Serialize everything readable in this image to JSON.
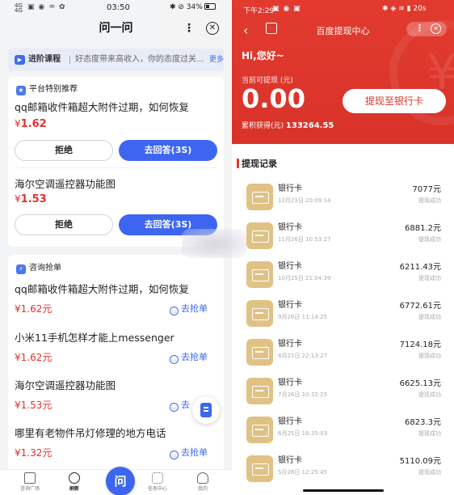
{
  "left": {
    "status": {
      "network": "4G 4G",
      "icons": "▣ ◉ ♒ ✿",
      "time": "03:50",
      "right": "✱ ⊘ 34%"
    },
    "title": "问一问",
    "more_label": "⋮",
    "close_label": "✕",
    "banner": {
      "tag": "进阶课程",
      "text": "好态度带来高收入，你的态度过关...",
      "more": "更多"
    },
    "section1": {
      "title": "平台特别推荐"
    },
    "recommended": [
      {
        "title": "qq邮箱收件箱超大附件过期，如何恢复",
        "price_symbol": "¥",
        "price": "1.62",
        "reject": "拒绝",
        "answer": "去回答(3S)"
      },
      {
        "title": "海尔空调遥控器功能图",
        "price_symbol": "¥",
        "price": "1.53",
        "reject": "拒绝",
        "answer": "去回答(3S)"
      }
    ],
    "section2": {
      "title": "咨询抢单"
    },
    "consult": [
      {
        "title": "qq邮箱收件箱超大附件过期，如何恢复",
        "price": "¥1.62元",
        "grab": "去抢单"
      },
      {
        "title": "小米11手机怎样才能上messenger",
        "price": "¥1.62元",
        "grab": "去抢单"
      },
      {
        "title": "海尔空调遥控器功能图",
        "price": "¥1.53元",
        "grab": "去"
      },
      {
        "title": "哪里有老物件吊灯修理的地方电话",
        "price": "¥1.32元",
        "grab": "去抢单"
      }
    ],
    "tabbar": [
      {
        "label": "咨询广场",
        "icon": "home-icon"
      },
      {
        "label": "刷新",
        "icon": "refresh-icon"
      },
      {
        "label": "问",
        "icon": "ask-icon"
      },
      {
        "label": "任务中心",
        "icon": "task-icon"
      },
      {
        "label": "我的",
        "icon": "profile-icon"
      }
    ]
  },
  "right": {
    "status": {
      "time": "下午2:29",
      "apps": "▣ ◉ ▣",
      "right": "✱ ◈ ≋ ▮ 20s"
    },
    "back_label": "‹",
    "title": "百度提现中心",
    "dots_label": "⋮",
    "close_label": "✕",
    "greeting": "Hi,您好~",
    "available_label": "当前可提现 (元)",
    "available_amount": "0.00",
    "withdraw_button": "提现至银行卡",
    "accum_label": "累积获得(元)",
    "accum_amount": "133264.55",
    "records_title": "提现记录",
    "records": [
      {
        "name": "银行卡",
        "date": "12月23日 20:09:14",
        "amount": "7077元",
        "status": "提现成功"
      },
      {
        "name": "银行卡",
        "date": "11月26日 10:53:27",
        "amount": "6881.2元",
        "status": "提现成功"
      },
      {
        "name": "银行卡",
        "date": "10月25日 21:04:39",
        "amount": "6211.43元",
        "status": "提现成功"
      },
      {
        "name": "银行卡",
        "date": "9月26日 11:14:25",
        "amount": "6772.61元",
        "status": "提现成功"
      },
      {
        "name": "银行卡",
        "date": "8月25日 22:13:27",
        "amount": "7124.18元",
        "status": "提现成功"
      },
      {
        "name": "银行卡",
        "date": "7月26日 10:32:25",
        "amount": "6625.13元",
        "status": "提现成功"
      },
      {
        "name": "银行卡",
        "date": "6月25日 18:35:03",
        "amount": "6823.3元",
        "status": "提现成功"
      },
      {
        "name": "银行卡",
        "date": "5月26日 12:25:45",
        "amount": "5110.09元",
        "status": "提现成功"
      }
    ],
    "colors": {
      "hero": "#e23a2e",
      "card_icon": "#e0c285"
    }
  }
}
